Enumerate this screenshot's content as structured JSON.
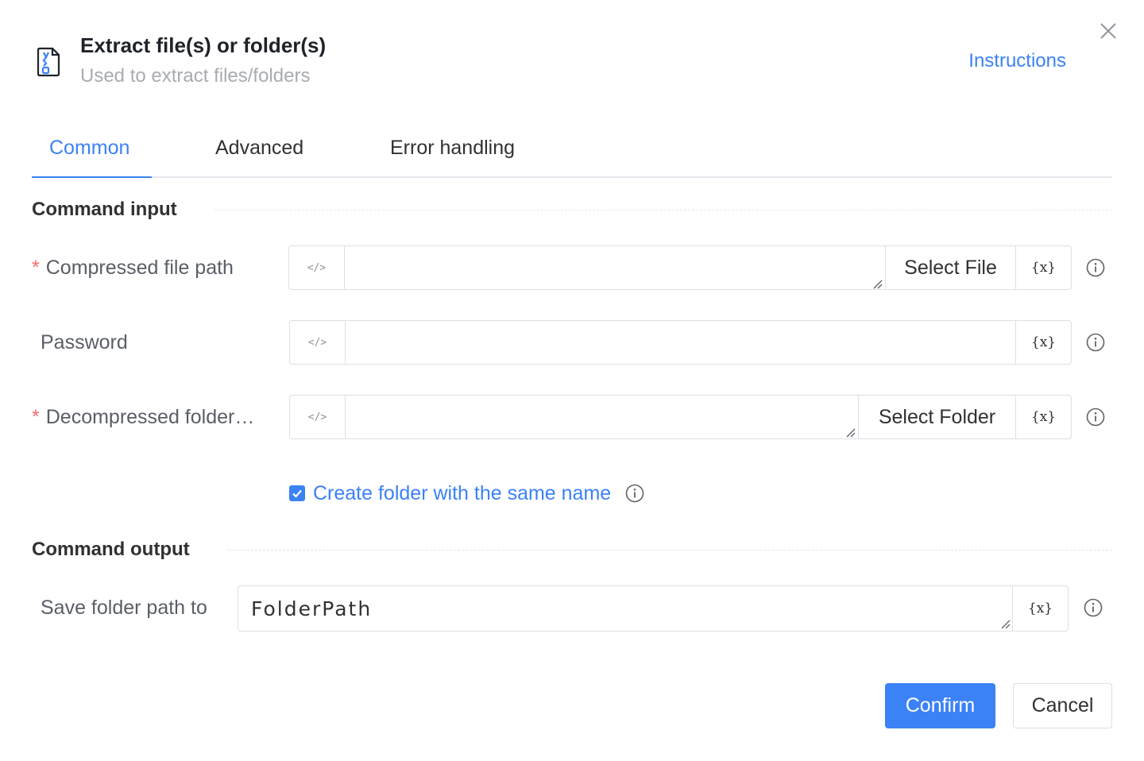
{
  "header": {
    "title": "Extract file(s) or folder(s)",
    "subtitle": "Used to extract files/folders",
    "instructions_link": "Instructions",
    "icon": "zip-file-icon",
    "close_icon": "close-icon"
  },
  "tabs": [
    {
      "label": "Common",
      "active": true
    },
    {
      "label": "Advanced",
      "active": false
    },
    {
      "label": "Error handling",
      "active": false
    }
  ],
  "sections": {
    "input_title": "Command input",
    "output_title": "Command output"
  },
  "fields": {
    "compressed_path": {
      "required_mark": "*",
      "label": "Compressed file path",
      "value": "",
      "select_button": "Select File",
      "code_toggle": "</>",
      "var_button": "{x}"
    },
    "password": {
      "label": "Password",
      "value": "",
      "code_toggle": "</>",
      "var_button": "{x}"
    },
    "decompressed_folder": {
      "required_mark": "*",
      "label": "Decompressed folder…",
      "value": "",
      "select_button": "Select Folder",
      "code_toggle": "</>",
      "var_button": "{x}"
    },
    "same_name_checkbox": {
      "label": "Create folder with the same name",
      "checked": true
    },
    "save_path": {
      "label": "Save folder path to",
      "value": "FolderPath",
      "var_button": "{x}"
    }
  },
  "footer": {
    "confirm": "Confirm",
    "cancel": "Cancel"
  },
  "colors": {
    "accent": "#3b82f6",
    "required": "#f56c6c",
    "border": "#dcdfe6"
  }
}
